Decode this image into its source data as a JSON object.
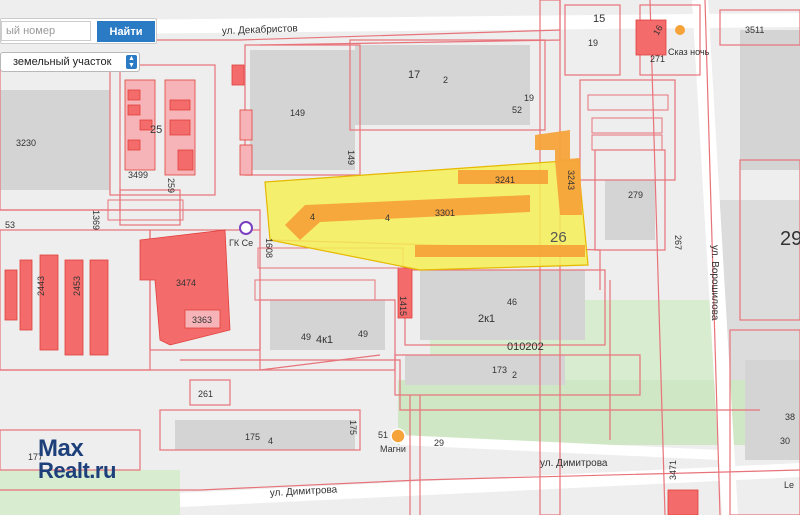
{
  "search": {
    "placeholder": "ый номер",
    "button_label": "Найти"
  },
  "object_type": {
    "selected": "земельный участок"
  },
  "streets": {
    "dekabristov": "ул. Декабристов",
    "dimitrova_upper": "ул. Димитрова",
    "dimitrova_lower": "ул. Димитрова",
    "voroshilova": "ул. Ворошилова"
  },
  "labels": {
    "p15": "15",
    "p19": "19",
    "p3511": "3511",
    "p271": "271",
    "p29big": "29",
    "p17": "17",
    "p2a": "2",
    "p19b": "19",
    "p52": "52",
    "p149": "149",
    "p149v": "149",
    "p25": "25",
    "p3230": "3230",
    "p3499": "3499",
    "p259": "259",
    "p53": "53",
    "p279": "279",
    "p267": "267",
    "p26": "26",
    "p3301": "3301",
    "p4a": "4",
    "p4b": "4",
    "p3241": "3241",
    "p3243": "3243",
    "p1608": "1608",
    "p3474": "3474",
    "p3363": "3363",
    "p2443": "2443",
    "p2453": "2453",
    "p46": "46",
    "p2k1": "2к1",
    "p1415": "1415",
    "p49a": "49",
    "p4k1": "4к1",
    "p49b": "49",
    "p010202": "010202",
    "p173": "173",
    "p2b": "2",
    "p261": "261",
    "p175": "175",
    "p4c": "4",
    "p175b": "175",
    "p51": "51",
    "p29": "29",
    "p38": "38",
    "p30": "30",
    "p177": "177",
    "p3471": "3471",
    "p1369": "1369",
    "p16": "16"
  },
  "pois": {
    "market": "Магни",
    "skaz": "Сказ ночь",
    "gk": "ГК Се",
    "le": "Le"
  },
  "watermark": {
    "line1": "Max",
    "line2": "Realt.ru"
  },
  "colors": {
    "parcel_outline": "#e8737a",
    "parcel_fill": "#f4a0a6",
    "building_fill": "#f46b6b",
    "highlight_fill": "#f5ef55",
    "highlight_stroke": "#e6b800",
    "orange_block": "#f6a33a",
    "map_bg": "#eeeeee",
    "green": "#cfe7c4",
    "road": "#ffffff",
    "button_blue": "#2b7bc4",
    "red_line": "#e0403c"
  }
}
